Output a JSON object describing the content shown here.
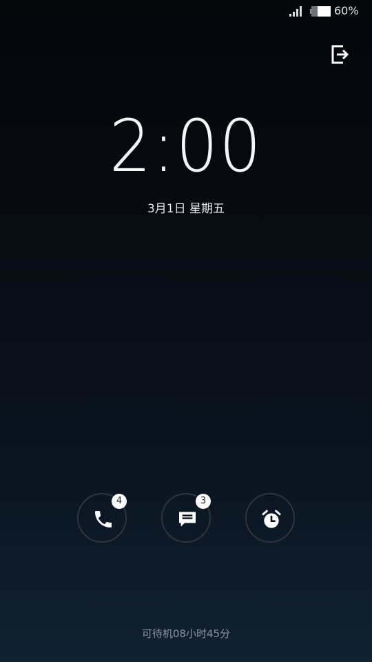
{
  "status_bar": {
    "battery_percent": "60%",
    "signal_icon": "signal-bars-icon",
    "battery_icon": "battery-icon",
    "battery_level": 0.6
  },
  "lock_screen": {
    "exit_icon": "exit-icon",
    "time": "2:00",
    "date": "3月1日 星期五"
  },
  "shortcuts": [
    {
      "name": "phone",
      "icon": "phone-icon",
      "badge": "4"
    },
    {
      "name": "messages",
      "icon": "message-icon",
      "badge": "3"
    },
    {
      "name": "alarm",
      "icon": "alarm-clock-icon",
      "badge": ""
    }
  ],
  "footer": {
    "standby_text": "可待机08小时45分"
  }
}
